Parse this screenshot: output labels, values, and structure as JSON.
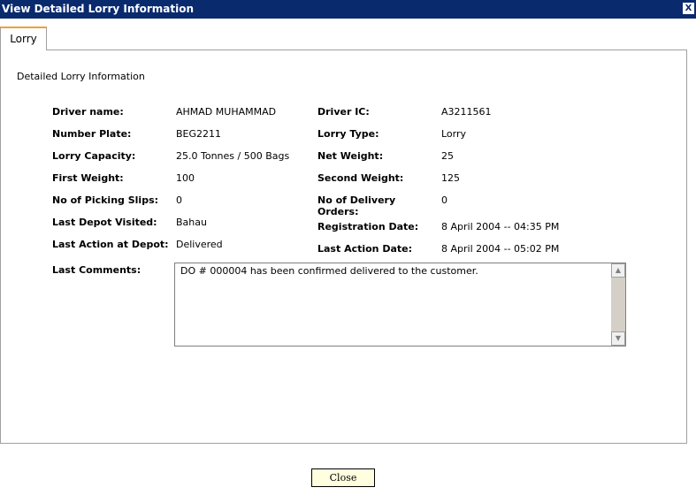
{
  "window": {
    "title": "View Detailed Lorry Information",
    "close_glyph": "X"
  },
  "tabs": [
    {
      "label": "Lorry"
    }
  ],
  "section_title": "Detailed Lorry Information",
  "fields": {
    "driver_name": {
      "label": "Driver name:",
      "value": "AHMAD MUHAMMAD"
    },
    "number_plate": {
      "label": "Number Plate:",
      "value": "BEG2211"
    },
    "lorry_capacity": {
      "label": "Lorry Capacity:",
      "value": "25.0 Tonnes / 500 Bags"
    },
    "first_weight": {
      "label": "First Weight:",
      "value": "100"
    },
    "picking_slips": {
      "label": "No of Picking Slips:",
      "value": "0"
    },
    "last_depot": {
      "label": "Last Depot Visited:",
      "value": "Bahau"
    },
    "last_action_depot": {
      "label": "Last Action at Depot:",
      "value": "Delivered"
    },
    "driver_ic": {
      "label": "Driver IC:",
      "value": "A3211561"
    },
    "lorry_type": {
      "label": "Lorry Type:",
      "value": "Lorry"
    },
    "net_weight": {
      "label": "Net Weight:",
      "value": "25"
    },
    "second_weight": {
      "label": "Second Weight:",
      "value": "125"
    },
    "delivery_orders": {
      "label": "No of Delivery Orders:",
      "value": "0"
    },
    "registration_date": {
      "label": "Registration Date:",
      "value": "8 April 2004 -- 04:35 PM"
    },
    "last_action_date": {
      "label": "Last Action Date:",
      "value": "8 April 2004 -- 05:02 PM"
    }
  },
  "comments": {
    "label": "Last Comments:",
    "value": "DO # 000004 has been confirmed delivered to the customer."
  },
  "footer": {
    "close_label": "Close"
  }
}
